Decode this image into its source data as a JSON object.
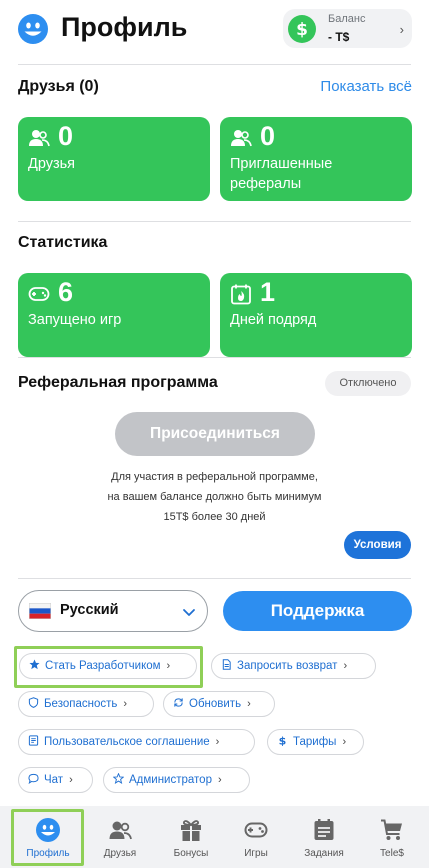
{
  "header": {
    "title": "Профиль",
    "balance_label": "Баланс",
    "balance_value": "- T$"
  },
  "friends": {
    "title": "Друзья (0)",
    "show_all": "Показать всё",
    "cards": [
      {
        "icon": "users-icon",
        "value": "0",
        "label": "Друзья"
      },
      {
        "icon": "users-icon",
        "value": "0",
        "label": "Приглашенные рефералы"
      }
    ]
  },
  "stats": {
    "title": "Статистика",
    "cards": [
      {
        "icon": "gamepad-icon",
        "value": "6",
        "label": "Запущено игр"
      },
      {
        "icon": "calendar-fire-icon",
        "value": "1",
        "label": "Дней подряд"
      }
    ]
  },
  "referral": {
    "title": "Реферальная программа",
    "status": "Отключено",
    "join_button": "Присоединиться",
    "note_line1": "Для участия в реферальной программе,",
    "note_line2": "на вашем балансе должно быть минимум",
    "note_line3": "15T$ более 30 дней",
    "terms_button": "Условия"
  },
  "language": {
    "selected": "Русский"
  },
  "support_button": "Поддержка",
  "actions": [
    {
      "icon": "star-icon",
      "label": "Стать Разработчиком"
    },
    {
      "icon": "document-icon",
      "label": "Запросить возврат"
    },
    {
      "icon": "shield-icon",
      "label": "Безопасность"
    },
    {
      "icon": "refresh-icon",
      "label": "Обновить"
    },
    {
      "icon": "agreement-icon",
      "label": "Пользовательское соглашение"
    },
    {
      "icon": "dollar-icon",
      "label": "Тарифы"
    },
    {
      "icon": "chat-icon",
      "label": "Чат"
    },
    {
      "icon": "star-outline-icon",
      "label": "Администратор"
    }
  ],
  "tabs": [
    {
      "icon": "profile-icon",
      "label": "Профиль",
      "active": true
    },
    {
      "icon": "friends-icon",
      "label": "Друзья"
    },
    {
      "icon": "gift-icon",
      "label": "Бонусы"
    },
    {
      "icon": "gamepad-icon",
      "label": "Игры"
    },
    {
      "icon": "tasks-icon",
      "label": "Задания"
    },
    {
      "icon": "cart-icon",
      "label": "Tele$"
    }
  ],
  "colors": {
    "accent_blue": "#2d8ef0",
    "card_green": "#34c55a",
    "highlight_green": "#8fcf57"
  }
}
